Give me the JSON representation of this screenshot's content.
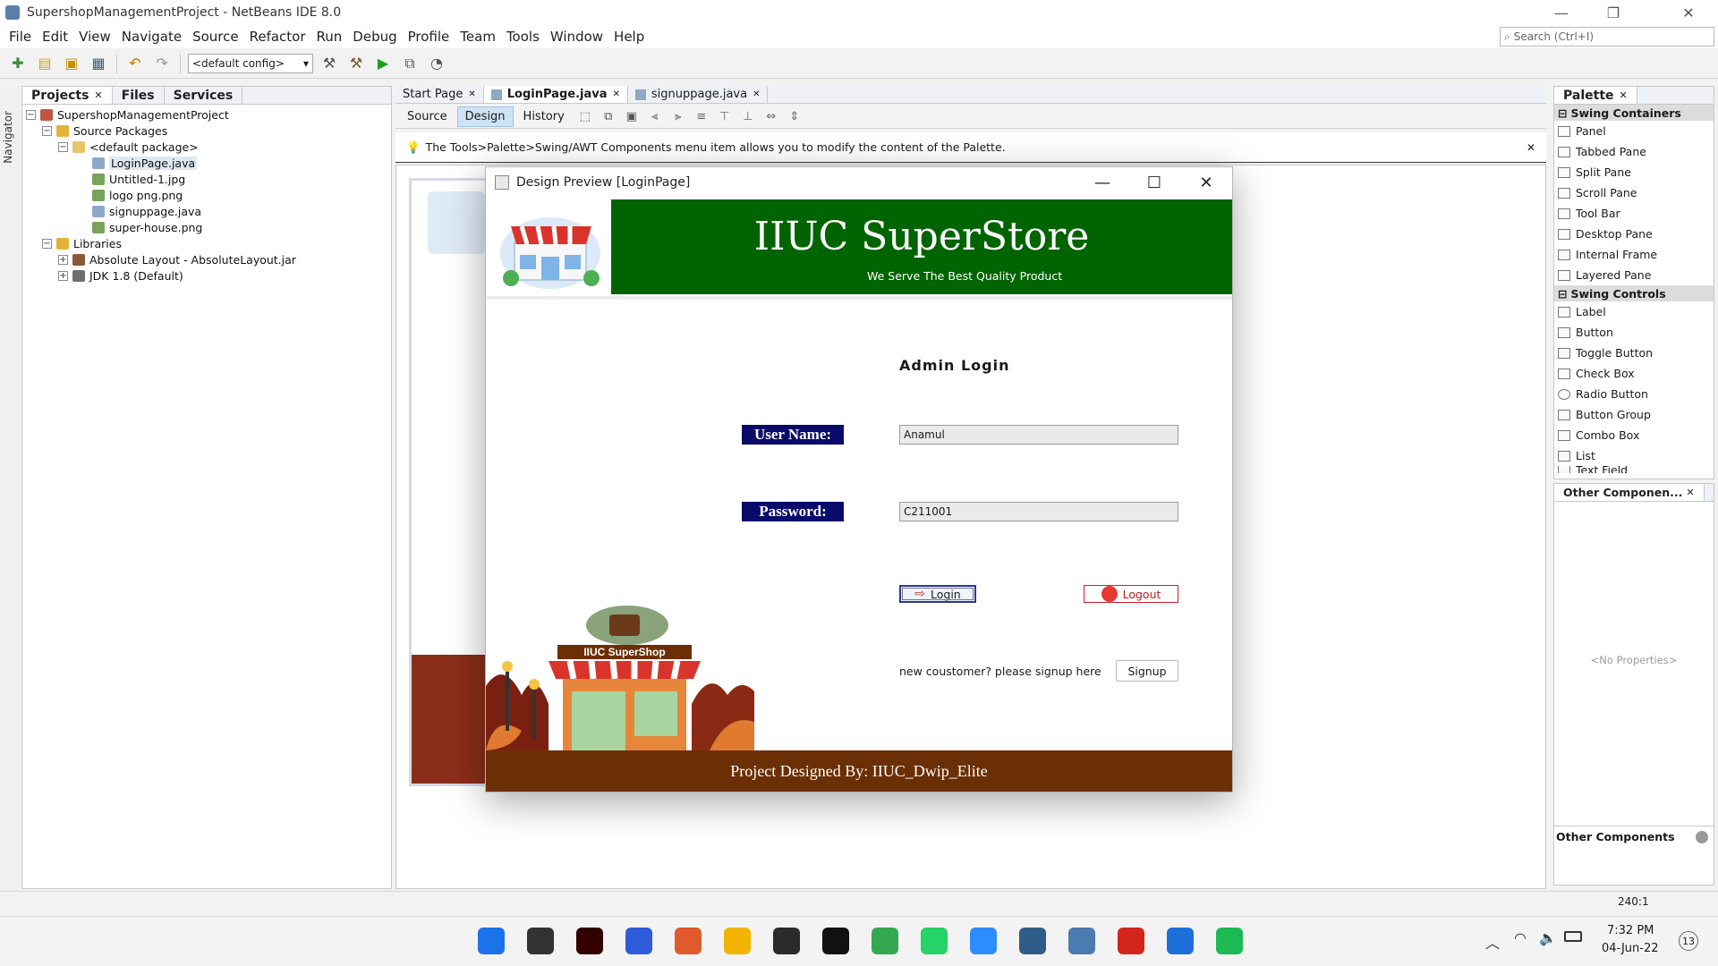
{
  "window": {
    "title": "SupershopManagementProject - NetBeans IDE 8.0"
  },
  "menu": [
    "File",
    "Edit",
    "View",
    "Navigate",
    "Source",
    "Refactor",
    "Run",
    "Debug",
    "Profile",
    "Team",
    "Tools",
    "Window",
    "Help"
  ],
  "search": {
    "placeholder": "Search (Ctrl+I)"
  },
  "toolbar": {
    "config": "<default config>"
  },
  "navigator": {
    "label": "Navigator"
  },
  "projects_panel": {
    "tabs": [
      "Projects",
      "Files",
      "Services"
    ],
    "tree": [
      {
        "label": "SupershopManagementProject",
        "level": 0
      },
      {
        "label": "Source Packages",
        "level": 1
      },
      {
        "label": "<default package>",
        "level": 2
      },
      {
        "label": "LoginPage.java",
        "level": 3
      },
      {
        "label": "Untitled-1.jpg",
        "level": 3
      },
      {
        "label": "logo png.png",
        "level": 3
      },
      {
        "label": "signuppage.java",
        "level": 3
      },
      {
        "label": "super-house.png",
        "level": 3
      },
      {
        "label": "Libraries",
        "level": 1
      },
      {
        "label": "Absolute Layout - AbsoluteLayout.jar",
        "level": 2
      },
      {
        "label": "JDK 1.8 (Default)",
        "level": 2
      }
    ]
  },
  "editor": {
    "tabs": [
      "Start Page",
      "LoginPage.java",
      "signuppage.java"
    ],
    "subtabs": [
      "Source",
      "Design",
      "History"
    ],
    "hint": "The Tools>Palette>Swing/AWT Components menu item allows you to modify the content of the Palette."
  },
  "palette": {
    "title": "Palette",
    "sections": [
      {
        "name": "Swing Containers",
        "items": [
          "Panel",
          "Tabbed Pane",
          "Split Pane",
          "Scroll Pane",
          "Tool Bar",
          "Desktop Pane",
          "Internal Frame",
          "Layered Pane"
        ]
      },
      {
        "name": "Swing Controls",
        "items": [
          "Label",
          "Button",
          "Toggle Button",
          "Check Box",
          "Radio Button",
          "Button Group",
          "Combo Box",
          "List",
          "Text Field"
        ]
      }
    ]
  },
  "other_panel": {
    "title": "Other Componen...",
    "empty": "<No Properties>",
    "footer": "Other Components"
  },
  "status": {
    "position": "240:1"
  },
  "preview": {
    "title": "Design Preview [LoginPage]",
    "banner_title": "IIUC SuperStore",
    "banner_subtitle": "We Serve The Best Quality Product",
    "heading": "Admin Login",
    "username_label": "User Name:",
    "username_value": "Anamul",
    "password_label": "Password:",
    "password_value": "C211001",
    "login_button": "Login",
    "logout_button": "Logout",
    "signup_prompt": "new coustomer? please signup here",
    "signup_button": "Signup",
    "shop_sign": "IIUC SuperShop",
    "footer": "Project Designed By: IIUC_Dwip_Elite"
  },
  "taskbar": {
    "time": "7:32 PM",
    "date": "04-Jun-22",
    "notification_count": "13",
    "apps": [
      {
        "name": "windows-start",
        "color": "#1a73e8"
      },
      {
        "name": "task-view",
        "color": "#333333"
      },
      {
        "name": "illustrator",
        "color": "#330000"
      },
      {
        "name": "app-blue",
        "color": "#2e5bd9"
      },
      {
        "name": "app-multicolor",
        "color": "#e05a2b"
      },
      {
        "name": "file-explorer",
        "color": "#f2b400"
      },
      {
        "name": "obs",
        "color": "#2b2b2b"
      },
      {
        "name": "intellij",
        "color": "#111111"
      },
      {
        "name": "chrome",
        "color": "#34a853"
      },
      {
        "name": "whatsapp",
        "color": "#25d366"
      },
      {
        "name": "zoom",
        "color": "#2d8cff"
      },
      {
        "name": "mysql-workbench",
        "color": "#2f5d8a"
      },
      {
        "name": "netbeans",
        "color": "#4b7bb0"
      },
      {
        "name": "acrobat",
        "color": "#d4251c"
      },
      {
        "name": "media-player",
        "color": "#1e6fd9"
      },
      {
        "name": "spotify",
        "color": "#1db954"
      }
    ]
  }
}
